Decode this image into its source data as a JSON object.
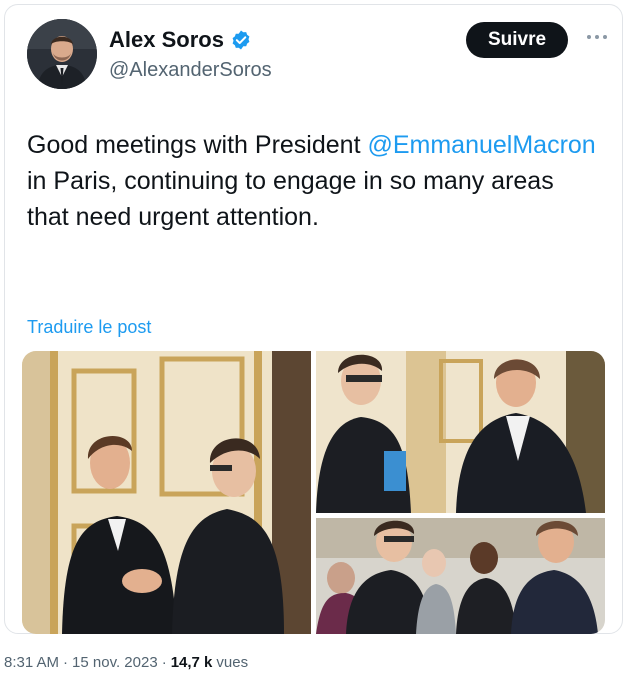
{
  "author": {
    "display_name": "Alex Soros",
    "handle": "@AlexanderSoros",
    "verified": true,
    "avatar_icon": "profile-photo"
  },
  "actions": {
    "follow_label": "Suivre",
    "more_icon": "more-horizontal-icon"
  },
  "tweet": {
    "text_before": "Good meetings with President ",
    "mention": "@EmmanuelMacron",
    "text_after": " in Paris, continuing to engage in so many areas that need urgent attention.",
    "translate_label": "Traduire le post"
  },
  "media": {
    "photo_count": 3
  },
  "meta": {
    "time": "8:31 AM",
    "separator": "·",
    "date": "15 nov. 2023",
    "views_count": "14,7 k",
    "views_label": "vues"
  },
  "colors": {
    "link": "#1d9bf0",
    "text": "#0f1419",
    "secondary": "#536471",
    "button_bg": "#0f1419"
  }
}
